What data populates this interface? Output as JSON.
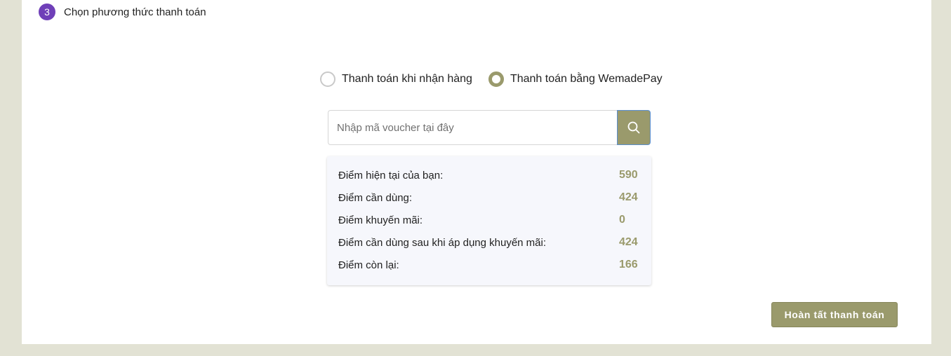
{
  "step": {
    "number": "3",
    "title": "Chọn phương thức thanh toán"
  },
  "payment_methods": [
    {
      "label": "Thanh toán khi nhận hàng",
      "selected": false
    },
    {
      "label": "Thanh toán bằng WemadePay",
      "selected": true
    }
  ],
  "voucher": {
    "placeholder": "Nhập mã voucher tại đây",
    "value": "",
    "search_icon": "search-icon"
  },
  "points": [
    {
      "label": "Điểm hiện tại của bạn:",
      "value": "590"
    },
    {
      "label": "Điểm cần dùng:",
      "value": "424"
    },
    {
      "label": "Điểm khuyến mãi:",
      "value": "0"
    },
    {
      "label": "Điểm cần dùng sau khi áp dụng khuyến mãi:",
      "value": "424"
    },
    {
      "label": "Điểm còn lại:",
      "value": "166"
    }
  ],
  "submit_label": "Hoàn tất thanh toán",
  "colors": {
    "accent": "#9a9a6c",
    "step_badge": "#6f3fb8",
    "page_background": "#e2e2d4",
    "points_panel": "#f6f7fc"
  }
}
